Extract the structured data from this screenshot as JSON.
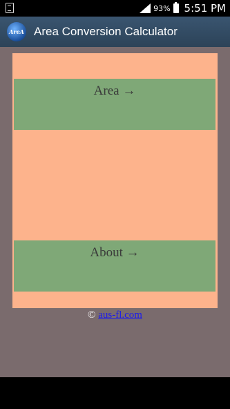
{
  "status_bar": {
    "battery_percent": "93%",
    "time": "5:51 PM"
  },
  "action_bar": {
    "logo_text": "AreA",
    "title": "Area Conversion Calculator"
  },
  "buttons": {
    "area_label": "Area →",
    "about_label": "About →"
  },
  "footer": {
    "copyright_symbol": "©",
    "link_text": "aus-fl.com"
  },
  "colors": {
    "action_bar": "#2c4358",
    "background": "#7a6b6d",
    "panel": "#fdb38c",
    "button": "#7fa877",
    "link": "#1a1aee"
  }
}
